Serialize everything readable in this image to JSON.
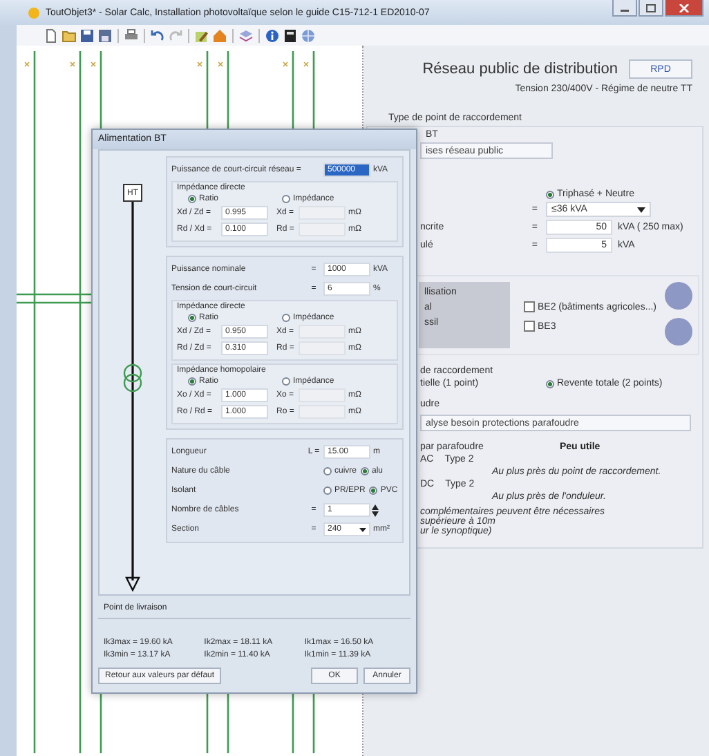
{
  "window": {
    "title": "ToutObjet3* - Solar Calc, Installation photovoltaïque selon le guide C15-712-1 ED2010-07"
  },
  "panel": {
    "title": "Réseau public de distribution",
    "badge": "RPD",
    "subtitle": "Tension 230/400V - Régime de neutre TT",
    "section_label": "Type de point de raccordement",
    "network_label": "BT",
    "network_button": "ises réseau public",
    "phase_option": {
      "label": "Triphasé + Neutre",
      "selected": true
    },
    "rows": [
      {
        "kind": "select",
        "label": "",
        "sign": "=",
        "value": "≤36 kVA"
      },
      {
        "kind": "field",
        "label": "ncrite",
        "sign": "=",
        "value": "50",
        "unit": "kVA ( 250 max)"
      },
      {
        "kind": "field",
        "label": "ulé",
        "sign": "=",
        "value": "5",
        "unit": "kVA"
      }
    ],
    "usage_labels": [
      "llisation",
      "al",
      "ssil"
    ],
    "checks": [
      {
        "label": "BE2 (bâtiments agricoles...)",
        "checked": false
      },
      {
        "label": "BE3",
        "checked": false
      }
    ],
    "connection_label": "de raccordement",
    "connection_text": "tielle (1 point)",
    "connection_option": {
      "label": "Revente totale (2 points)",
      "selected": true
    },
    "surge_label": "udre",
    "surge_button": "alyse besoin protections parafoudre",
    "surge_need_label": "par parafoudre",
    "surge_need": "Peu utile",
    "protections": [
      {
        "side": "AC",
        "type": "Type 2",
        "note": "Au plus près du point de raccordement."
      },
      {
        "side": "DC",
        "type": "Type 2",
        "note": "Au plus près de l'onduleur."
      }
    ],
    "notes": [
      "complémentaires peuvent être nécessaires",
      "supérieure à 10m",
      "ur le synoptique)"
    ]
  },
  "dialog": {
    "title": "Alimentation BT",
    "source": "HT",
    "sections": [
      {
        "items": [
          {
            "kind": "field",
            "label": "Puissance de court-circuit réseau =",
            "value": "500000",
            "unit": "kVA",
            "selected": true
          },
          {
            "kind": "group",
            "title": "Impédance directe",
            "options": [
              {
                "label": "Ratio",
                "selected": true
              },
              {
                "label": "Impédance",
                "selected": false
              }
            ],
            "pairs": [
              {
                "ratio_label": "Xd / Zd =",
                "ratio_value": "0.995",
                "abs_label": "Xd =",
                "unit": "mΩ"
              },
              {
                "ratio_label": "Rd / Xd =",
                "ratio_value": "0.100",
                "abs_label": "Rd =",
                "unit": "mΩ"
              }
            ]
          }
        ]
      },
      {
        "items": [
          {
            "kind": "field",
            "label": "Puissance nominale",
            "sign": "=",
            "value": "1000",
            "unit": "kVA",
            "selected": false
          },
          {
            "kind": "field",
            "label": "Tension de court-circuit",
            "sign": "=",
            "value": "6",
            "unit": "%",
            "selected": false
          },
          {
            "kind": "group",
            "title": "Impédance directe",
            "options": [
              {
                "label": "Ratio",
                "selected": true
              },
              {
                "label": "Impédance",
                "selected": false
              }
            ],
            "pairs": [
              {
                "ratio_label": "Xd / Zd =",
                "ratio_value": "0.950",
                "abs_label": "Xd =",
                "unit": "mΩ"
              },
              {
                "ratio_label": "Rd / Zd =",
                "ratio_value": "0.310",
                "abs_label": "Rd =",
                "unit": "mΩ"
              }
            ]
          },
          {
            "kind": "group",
            "title": "Impédance homopolaire",
            "options": [
              {
                "label": "Ratio",
                "selected": true
              },
              {
                "label": "Impédance",
                "selected": false
              }
            ],
            "pairs": [
              {
                "ratio_label": "Xo / Xd =",
                "ratio_value": "1.000",
                "abs_label": "Xo =",
                "unit": "mΩ"
              },
              {
                "ratio_label": "Ro / Rd =",
                "ratio_value": "1.000",
                "abs_label": "Ro =",
                "unit": "mΩ"
              }
            ]
          }
        ]
      },
      {
        "items": [
          {
            "kind": "field",
            "label": "Longueur",
            "sign": "L =",
            "value": "15.00",
            "unit": "m",
            "selected": false
          },
          {
            "kind": "choice",
            "label": "Nature du câble",
            "options": [
              {
                "label": "cuivre",
                "selected": false
              },
              {
                "label": "alu",
                "selected": true
              }
            ]
          },
          {
            "kind": "choice",
            "label": "Isolant",
            "options": [
              {
                "label": "PR/EPR",
                "selected": false
              },
              {
                "label": "PVC",
                "selected": true
              }
            ]
          },
          {
            "kind": "spinner",
            "label": "Nombre de câbles",
            "sign": "=",
            "value": "1"
          },
          {
            "kind": "select",
            "label": "Section",
            "sign": "=",
            "value": "240",
            "unit": "mm²"
          }
        ]
      }
    ],
    "delivery_label": "Point de livraison",
    "results": [
      "Ik3max = 19.60 kA",
      "Ik2max = 18.11 kA",
      "Ik1max = 16.50 kA",
      "Ik3min = 13.17 kA",
      "Ik2min = 11.40 kA",
      "Ik1min = 11.39 kA"
    ],
    "reset_button": "Retour aux valeurs par défaut",
    "buttons": [
      "OK",
      "Annuler"
    ]
  }
}
